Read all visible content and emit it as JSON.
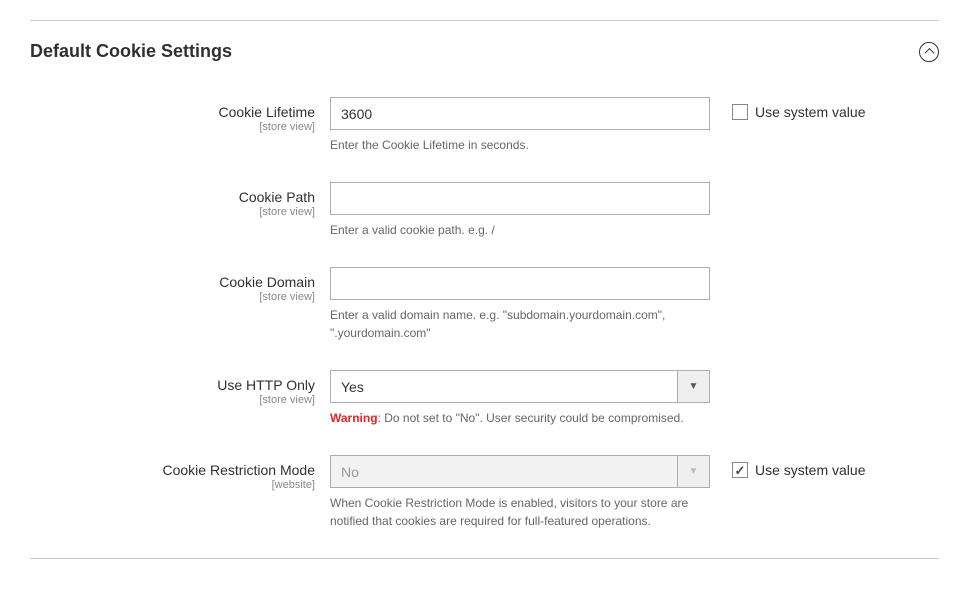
{
  "section": {
    "title": "Default Cookie Settings"
  },
  "fields": {
    "lifetime": {
      "label": "Cookie Lifetime",
      "scope": "[store view]",
      "value": "3600",
      "note": "Enter the Cookie Lifetime in seconds.",
      "system_label": "Use system value"
    },
    "path": {
      "label": "Cookie Path",
      "scope": "[store view]",
      "value": "",
      "note": "Enter a valid cookie path. e.g. /"
    },
    "domain": {
      "label": "Cookie Domain",
      "scope": "[store view]",
      "value": "",
      "note": "Enter a valid domain name. e.g. \"subdomain.yourdomain.com\", \".yourdomain.com\""
    },
    "httponly": {
      "label": "Use HTTP Only",
      "scope": "[store view]",
      "value": "Yes",
      "warn_prefix": "Warning",
      "warn_text": ": Do not set to \"No\". User security could be compromised."
    },
    "restriction": {
      "label": "Cookie Restriction Mode",
      "scope": "[website]",
      "value": "No",
      "note": "When Cookie Restriction Mode is enabled, visitors to your store are notified that cookies are required for full-featured operations.",
      "system_label": "Use system value"
    }
  }
}
